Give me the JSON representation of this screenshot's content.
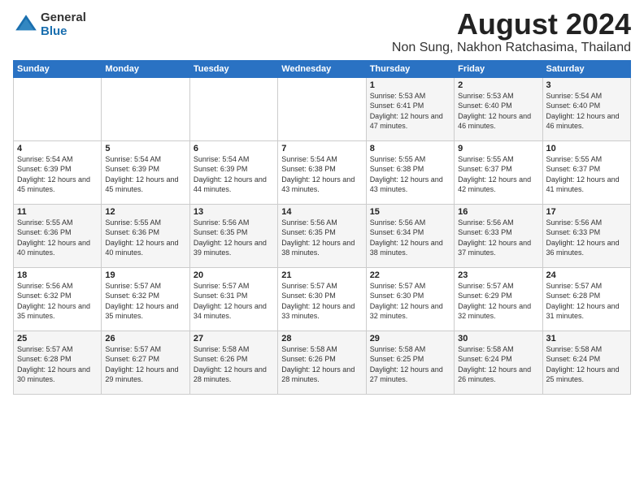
{
  "logo": {
    "general": "General",
    "blue": "Blue"
  },
  "title": "August 2024",
  "location": "Non Sung, Nakhon Ratchasima, Thailand",
  "headers": [
    "Sunday",
    "Monday",
    "Tuesday",
    "Wednesday",
    "Thursday",
    "Friday",
    "Saturday"
  ],
  "weeks": [
    [
      {
        "day": "",
        "info": ""
      },
      {
        "day": "",
        "info": ""
      },
      {
        "day": "",
        "info": ""
      },
      {
        "day": "",
        "info": ""
      },
      {
        "day": "1",
        "info": "Sunrise: 5:53 AM\nSunset: 6:41 PM\nDaylight: 12 hours\nand 47 minutes."
      },
      {
        "day": "2",
        "info": "Sunrise: 5:53 AM\nSunset: 6:40 PM\nDaylight: 12 hours\nand 46 minutes."
      },
      {
        "day": "3",
        "info": "Sunrise: 5:54 AM\nSunset: 6:40 PM\nDaylight: 12 hours\nand 46 minutes."
      }
    ],
    [
      {
        "day": "4",
        "info": "Sunrise: 5:54 AM\nSunset: 6:39 PM\nDaylight: 12 hours\nand 45 minutes."
      },
      {
        "day": "5",
        "info": "Sunrise: 5:54 AM\nSunset: 6:39 PM\nDaylight: 12 hours\nand 45 minutes."
      },
      {
        "day": "6",
        "info": "Sunrise: 5:54 AM\nSunset: 6:39 PM\nDaylight: 12 hours\nand 44 minutes."
      },
      {
        "day": "7",
        "info": "Sunrise: 5:54 AM\nSunset: 6:38 PM\nDaylight: 12 hours\nand 43 minutes."
      },
      {
        "day": "8",
        "info": "Sunrise: 5:55 AM\nSunset: 6:38 PM\nDaylight: 12 hours\nand 43 minutes."
      },
      {
        "day": "9",
        "info": "Sunrise: 5:55 AM\nSunset: 6:37 PM\nDaylight: 12 hours\nand 42 minutes."
      },
      {
        "day": "10",
        "info": "Sunrise: 5:55 AM\nSunset: 6:37 PM\nDaylight: 12 hours\nand 41 minutes."
      }
    ],
    [
      {
        "day": "11",
        "info": "Sunrise: 5:55 AM\nSunset: 6:36 PM\nDaylight: 12 hours\nand 40 minutes."
      },
      {
        "day": "12",
        "info": "Sunrise: 5:55 AM\nSunset: 6:36 PM\nDaylight: 12 hours\nand 40 minutes."
      },
      {
        "day": "13",
        "info": "Sunrise: 5:56 AM\nSunset: 6:35 PM\nDaylight: 12 hours\nand 39 minutes."
      },
      {
        "day": "14",
        "info": "Sunrise: 5:56 AM\nSunset: 6:35 PM\nDaylight: 12 hours\nand 38 minutes."
      },
      {
        "day": "15",
        "info": "Sunrise: 5:56 AM\nSunset: 6:34 PM\nDaylight: 12 hours\nand 38 minutes."
      },
      {
        "day": "16",
        "info": "Sunrise: 5:56 AM\nSunset: 6:33 PM\nDaylight: 12 hours\nand 37 minutes."
      },
      {
        "day": "17",
        "info": "Sunrise: 5:56 AM\nSunset: 6:33 PM\nDaylight: 12 hours\nand 36 minutes."
      }
    ],
    [
      {
        "day": "18",
        "info": "Sunrise: 5:56 AM\nSunset: 6:32 PM\nDaylight: 12 hours\nand 35 minutes."
      },
      {
        "day": "19",
        "info": "Sunrise: 5:57 AM\nSunset: 6:32 PM\nDaylight: 12 hours\nand 35 minutes."
      },
      {
        "day": "20",
        "info": "Sunrise: 5:57 AM\nSunset: 6:31 PM\nDaylight: 12 hours\nand 34 minutes."
      },
      {
        "day": "21",
        "info": "Sunrise: 5:57 AM\nSunset: 6:30 PM\nDaylight: 12 hours\nand 33 minutes."
      },
      {
        "day": "22",
        "info": "Sunrise: 5:57 AM\nSunset: 6:30 PM\nDaylight: 12 hours\nand 32 minutes."
      },
      {
        "day": "23",
        "info": "Sunrise: 5:57 AM\nSunset: 6:29 PM\nDaylight: 12 hours\nand 32 minutes."
      },
      {
        "day": "24",
        "info": "Sunrise: 5:57 AM\nSunset: 6:28 PM\nDaylight: 12 hours\nand 31 minutes."
      }
    ],
    [
      {
        "day": "25",
        "info": "Sunrise: 5:57 AM\nSunset: 6:28 PM\nDaylight: 12 hours\nand 30 minutes."
      },
      {
        "day": "26",
        "info": "Sunrise: 5:57 AM\nSunset: 6:27 PM\nDaylight: 12 hours\nand 29 minutes."
      },
      {
        "day": "27",
        "info": "Sunrise: 5:58 AM\nSunset: 6:26 PM\nDaylight: 12 hours\nand 28 minutes."
      },
      {
        "day": "28",
        "info": "Sunrise: 5:58 AM\nSunset: 6:26 PM\nDaylight: 12 hours\nand 28 minutes."
      },
      {
        "day": "29",
        "info": "Sunrise: 5:58 AM\nSunset: 6:25 PM\nDaylight: 12 hours\nand 27 minutes."
      },
      {
        "day": "30",
        "info": "Sunrise: 5:58 AM\nSunset: 6:24 PM\nDaylight: 12 hours\nand 26 minutes."
      },
      {
        "day": "31",
        "info": "Sunrise: 5:58 AM\nSunset: 6:24 PM\nDaylight: 12 hours\nand 25 minutes."
      }
    ]
  ]
}
